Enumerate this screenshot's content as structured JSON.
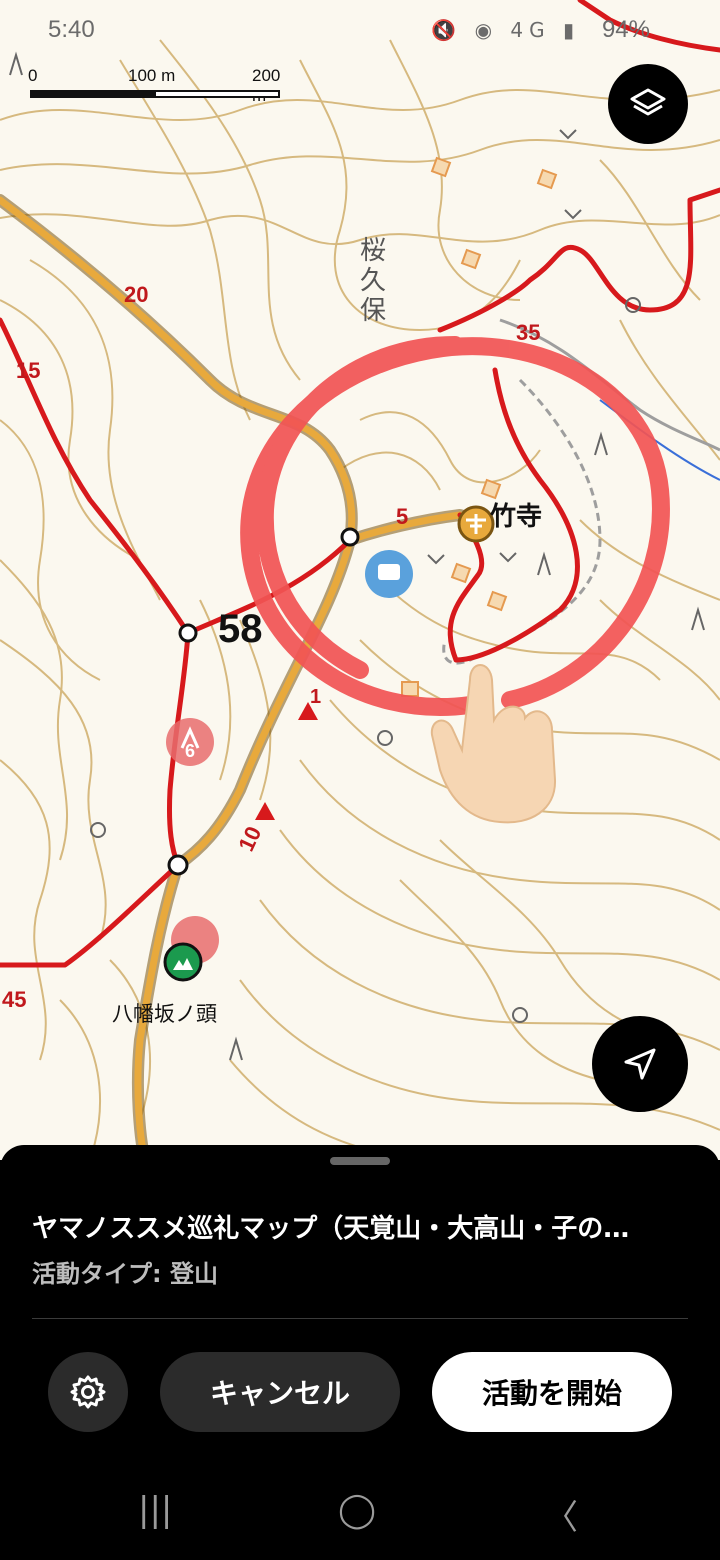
{
  "status_bar": {
    "time": "5:40",
    "battery": "94%",
    "icons": "🔇 ◉ 4G ▮"
  },
  "scale": {
    "zero": "0",
    "mid": "100 m",
    "end": "200 m"
  },
  "map": {
    "place_take_dera": "竹寺",
    "place_sakukubo": "桜久保",
    "place_yawatazaka": "八幡坂ノ頭",
    "peak_number": "58",
    "contour_labels": {
      "c20": "20",
      "c15": "15",
      "c35": "35",
      "c5": "5",
      "c45": "45",
      "c10": "10",
      "c1": "1"
    },
    "marker_number": "6"
  },
  "icons": {
    "layers": "layers-icon",
    "navigate": "navigation-arrow-icon",
    "settings": "gear-icon"
  },
  "colors": {
    "route_red": "#d7191c",
    "trail_orange": "#e3a43a",
    "contour": "#c9a050",
    "annotation_circle": "#f25454"
  },
  "sheet": {
    "title": "ヤマノススメ巡礼マップ（天覚山・大高山・子の…",
    "subtitle": "活動タイプ: 登山",
    "cancel_label": "キャンセル",
    "start_label": "活動を開始"
  },
  "navbar": {
    "recents": "|||",
    "home": "◯",
    "back": "〈"
  }
}
